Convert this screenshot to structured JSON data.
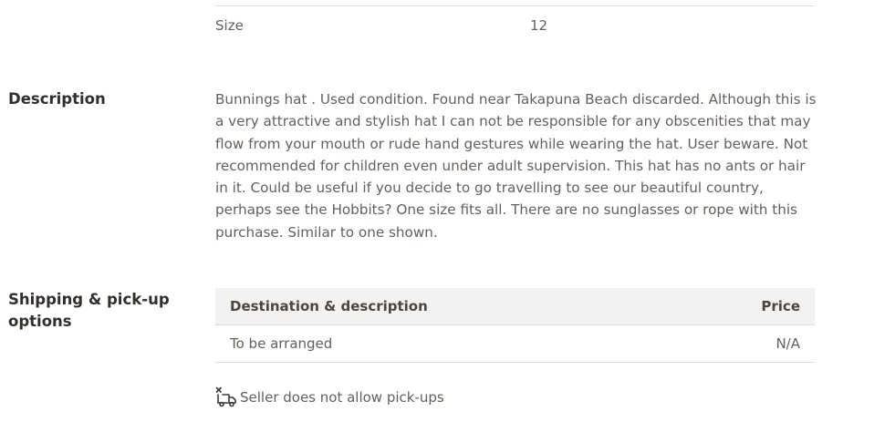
{
  "attributes": {
    "size_label": "Size",
    "size_value": "12"
  },
  "description": {
    "heading": "Description",
    "text": "Bunnings hat . Used condition. Found near Takapuna Beach discarded. Although this is a very attractive and stylish hat I can not be responsible for any obscenities that may flow from your mouth or rude hand gestures while wearing the hat. User beware. Not recommended for children even under adult supervision. This hat has no ants or hair in it. Could be useful if you decide to go travelling to see our beautiful country, perhaps see the Hobbits? One size fits all. There are no sunglasses or rope with this purchase. Similar to one shown."
  },
  "shipping": {
    "heading": "Shipping & pick-up options",
    "columns": {
      "destination": "Destination & description",
      "price": "Price"
    },
    "rows": [
      {
        "destination": "To be arranged",
        "price": "N/A"
      }
    ],
    "pickup_note": "Seller does not allow pick-ups",
    "pickup_icon": "no-pickup-truck-icon"
  }
}
